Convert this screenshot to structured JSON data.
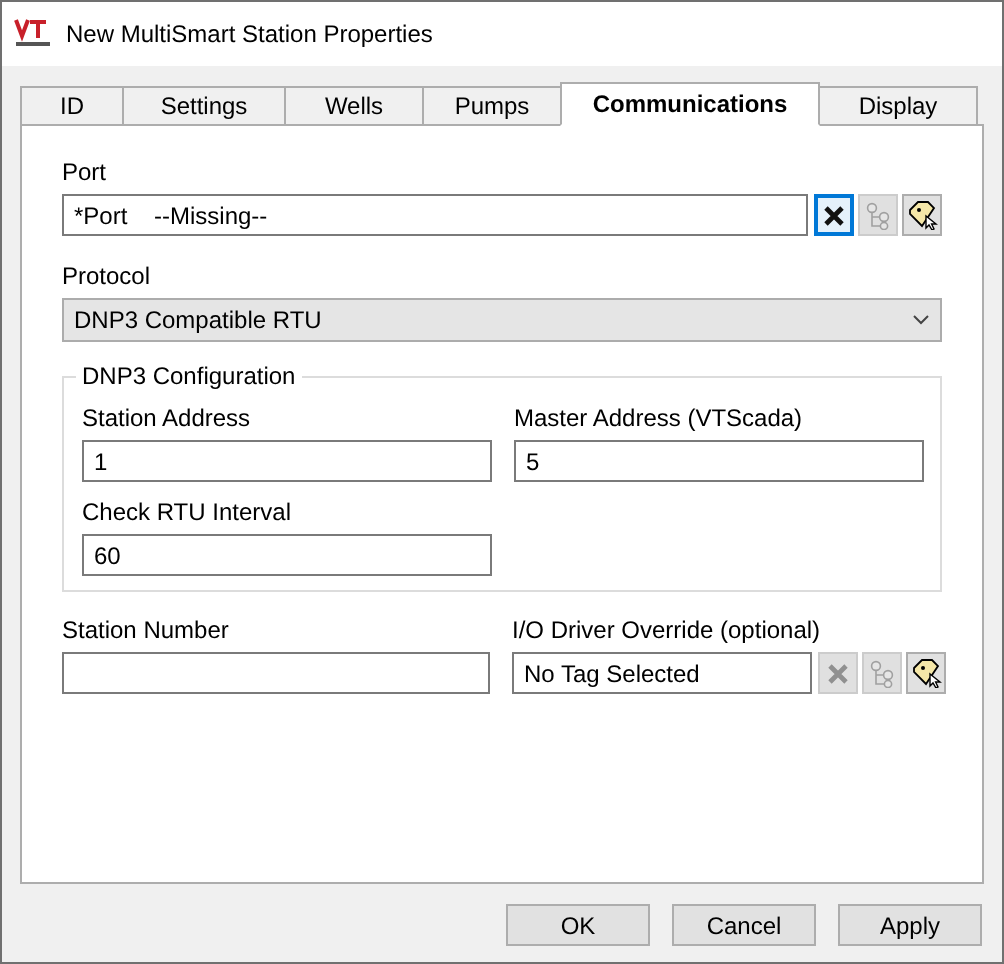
{
  "window": {
    "title": "New MultiSmart Station Properties"
  },
  "tabs": [
    {
      "label": "ID",
      "selected": false
    },
    {
      "label": "Settings",
      "selected": false
    },
    {
      "label": "Wells",
      "selected": false
    },
    {
      "label": "Pumps",
      "selected": false
    },
    {
      "label": "Communications",
      "selected": true
    },
    {
      "label": "Display",
      "selected": false
    }
  ],
  "port": {
    "label": "Port",
    "value": "*Port    --Missing--",
    "tools": [
      {
        "kind": "clear",
        "disabled": false,
        "focused": true
      },
      {
        "kind": "tree",
        "disabled": true,
        "focused": false
      },
      {
        "kind": "tag",
        "disabled": false,
        "focused": false
      }
    ]
  },
  "protocol": {
    "label": "Protocol",
    "value": "DNP3 Compatible RTU"
  },
  "dnp3_group": {
    "title": "DNP3 Configuration",
    "fields": [
      {
        "label": "Station Address",
        "value": "1"
      },
      {
        "label": "Master Address (VTScada)",
        "value": "5"
      },
      {
        "label": "Check RTU Interval",
        "value": "60"
      }
    ]
  },
  "station_number": {
    "label": "Station Number"
  },
  "io_driver": {
    "label": "I/O Driver Override (optional)",
    "value": "No Tag Selected",
    "tools": [
      {
        "kind": "clear",
        "disabled": true,
        "focused": false
      },
      {
        "kind": "tree",
        "disabled": true,
        "focused": false
      },
      {
        "kind": "tag",
        "disabled": false,
        "focused": false
      }
    ]
  },
  "buttons": [
    "OK",
    "Cancel",
    "Apply"
  ]
}
